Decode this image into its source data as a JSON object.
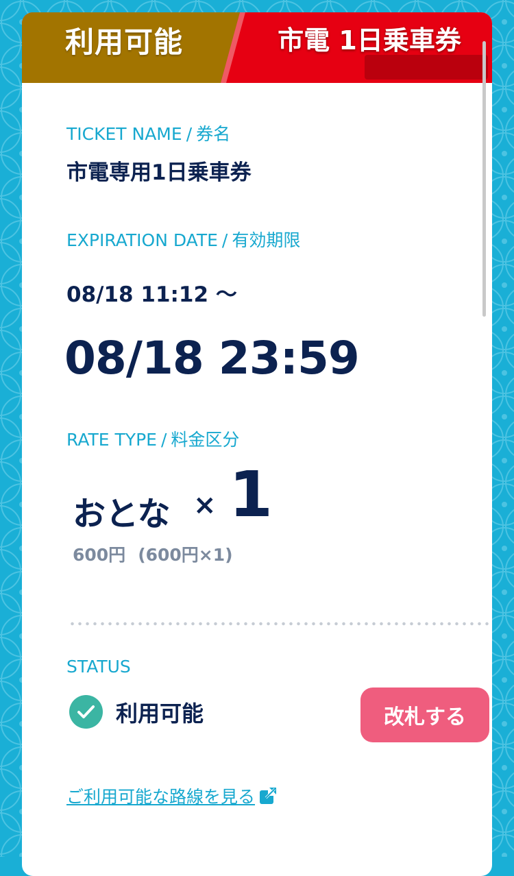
{
  "banner": {
    "status": "利用可能",
    "title": "市電 1日乗車券"
  },
  "ticket_name": {
    "label_en": "TICKET NAME",
    "separator": "/",
    "label_ja": "券名",
    "value": "市電専用1日乗車券"
  },
  "expiration": {
    "label_en": "EXPIRATION DATE",
    "separator": "/",
    "label_ja": "有効期限",
    "from": "08/18 11:12 〜",
    "to": "08/18 23:59"
  },
  "rate": {
    "label_en": "RATE TYPE",
    "separator": "/",
    "label_ja": "料金区分",
    "type": "おとな",
    "times": "×",
    "quantity": "1",
    "price": "600円",
    "calculation": "(600円×1)"
  },
  "status": {
    "label": "STATUS",
    "value": "利用可能",
    "icon": "check-circle-icon"
  },
  "actions": {
    "gate_button": "改札する",
    "routes_link": "ご利用可能な路線を見る",
    "routes_link_icon": "external-link-icon"
  },
  "colors": {
    "background": "#1aafd6",
    "accent": "#17a8cf",
    "text_dark": "#0c2250",
    "banner_status": "#a27400",
    "banner_title": "#e60012",
    "status_ok": "#3bb5a3",
    "gate_button": "#ef5d7e"
  }
}
